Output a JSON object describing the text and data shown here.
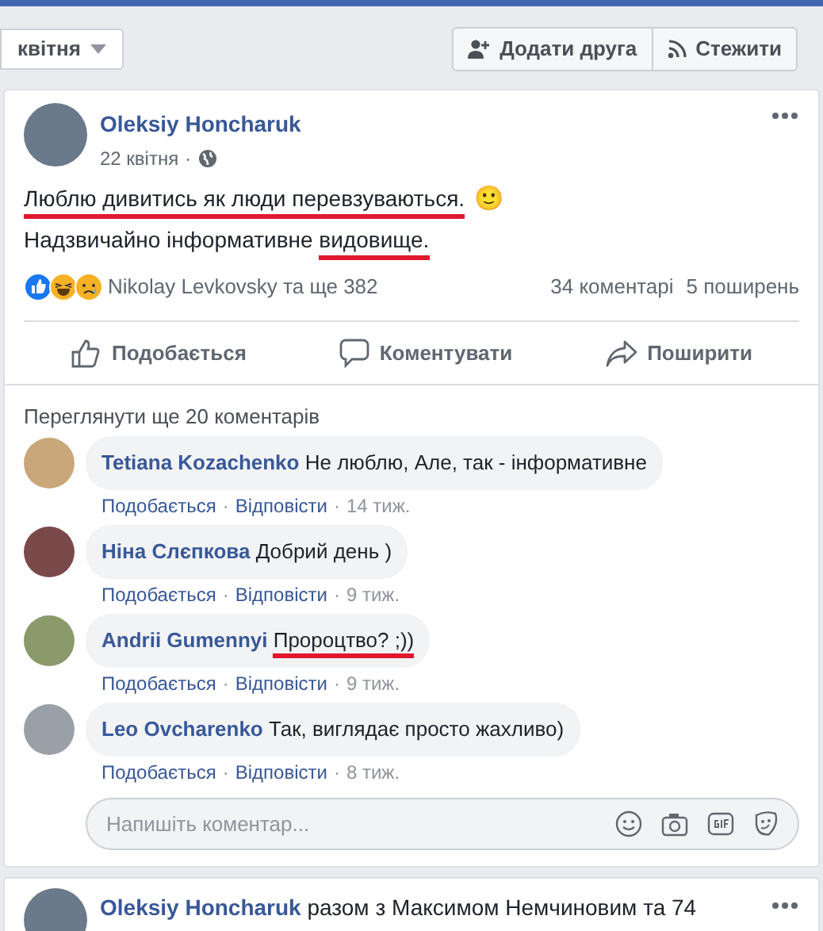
{
  "date_filter": {
    "label": "квітня"
  },
  "profile_buttons": [
    {
      "kind": "add-friend",
      "label": "Додати друга"
    },
    {
      "kind": "follow",
      "label": "Стежити"
    }
  ],
  "post": {
    "author": "Oleksiy Honcharuk",
    "date": "22 квітня",
    "separator": "·",
    "lines": [
      {
        "segments": [
          {
            "text": "Люблю дивитись як люди перевзуваються.",
            "marked": true
          }
        ],
        "emoji": "🙂"
      },
      {
        "segments": [
          {
            "text": "Надзвичайно інформативне ",
            "marked": false
          },
          {
            "text": "видовище.",
            "marked": true
          }
        ]
      }
    ],
    "reactions_text": "Nikolay Levkovsky та ще 382",
    "comments_count": "34 коментарі",
    "shares_count": "5 поширень",
    "actions": [
      {
        "kind": "like",
        "label": "Подобається"
      },
      {
        "kind": "comment",
        "label": "Коментувати"
      },
      {
        "kind": "share",
        "label": "Поширити"
      }
    ],
    "more_comments": "Переглянути ще 20 коментарів",
    "comments": [
      {
        "author": "Tetiana Kozachenko",
        "text": "Не люблю, Але, так - інформативне",
        "marked": false,
        "like": "Подобається",
        "reply": "Відповісти",
        "time": "14 тиж."
      },
      {
        "author": "Ніна Слєпкова",
        "text": "Добрий день )",
        "marked": false,
        "like": "Подобається",
        "reply": "Відповісти",
        "time": "9 тиж."
      },
      {
        "author": "Andrii Gumennyi",
        "text": "Пророцтво? ;))",
        "marked": true,
        "like": "Подобається",
        "reply": "Відповісти",
        "time": "9 тиж."
      },
      {
        "author": "Leo Ovcharenko",
        "text": "Так, виглядає просто жахливо)",
        "marked": false,
        "like": "Подобається",
        "reply": "Відповісти",
        "time": "8 тиж."
      }
    ],
    "comment_input": {
      "placeholder": "Напишіть коментар..."
    }
  },
  "next_post": {
    "author": "Oleksiy Honcharuk",
    "text": "разом з Максимом Немчиновим та 74"
  }
}
